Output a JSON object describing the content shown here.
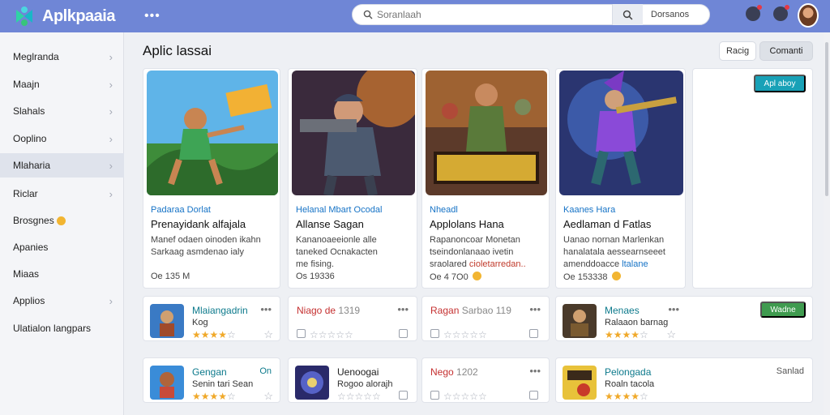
{
  "app": {
    "name": "Aplkpaaia",
    "menu_icon": "more-dots-icon"
  },
  "search": {
    "placeholder": "Soranlaah",
    "scope": "Dorsanos"
  },
  "header_icons": [
    "notification-icon",
    "settings-icon"
  ],
  "sidebar": {
    "items": [
      {
        "label": "Meglranda"
      },
      {
        "label": "Maajn"
      },
      {
        "label": "Slahals"
      },
      {
        "label": "Ooplino"
      },
      {
        "label": "Mlaharia"
      },
      {
        "label": "Riclar"
      },
      {
        "label": "Brosgnes"
      },
      {
        "label": "Apanies"
      },
      {
        "label": "Miaas"
      },
      {
        "label": "Applios"
      },
      {
        "label": "Ulatialon langpars"
      }
    ]
  },
  "main": {
    "title": "Aplic lassai",
    "btn_a": "Racig",
    "btn_b": "Comanti",
    "blank_button": "Apl aboy"
  },
  "featured": [
    {
      "category": "Padaraa Dorlat",
      "title": "Prenayidank alfajala",
      "desc1": "Manef odaen oinoden ikahn",
      "desc2": "Sarkaag asmdenao ialy",
      "desc3": "",
      "meta": "Oe 135 M"
    },
    {
      "category": "Helanal Mbart Ocodal",
      "title": "Allanse Sagan",
      "desc1": "Kananoaeeionle alle",
      "desc2": "taneked Ocnakacten",
      "desc3": "me fising.",
      "meta": "Os 19336"
    },
    {
      "category": "Nheadl",
      "title": "Applolans Hana",
      "desc1": "Rapanoncoar Monetan",
      "desc2": "tseindonlanaao ivetin",
      "desc3_a": "sraolared",
      "desc3_b": "cioletarredan..",
      "meta": "Oe 4 7O0"
    },
    {
      "category": "Kaanes Hara",
      "title": "Aedlaman d Fatlas",
      "desc1": "Uanao nornan Marlenkan",
      "desc2": "hanalatala aessearnseeet",
      "desc3_a": "amenddoacce",
      "desc3_b": "ltalane",
      "meta": "Oe 153338"
    }
  ],
  "row1": [
    {
      "name": "Mlaiangadrin",
      "sub": "Kog",
      "stars": "★★★★",
      "off": "☆",
      "more": "•••"
    },
    {
      "name": "Niago de",
      "extra_num": "1319",
      "more": "•••",
      "stars_off": "☆☆☆☆☆"
    },
    {
      "name": "Ragan",
      "name2": "Sarbao 119",
      "more": "•••",
      "stars_off": "☆☆☆☆☆"
    },
    {
      "name": "Menaes",
      "sub": "Ralaaon barnag",
      "stars": "★★★★",
      "off": "☆",
      "more": "•••",
      "button": "Wadne"
    }
  ],
  "row2": [
    {
      "name": "Gengan",
      "extra": "On",
      "sub": "Senin tari Sean",
      "stars": "★★★★",
      "off": "☆"
    },
    {
      "name": "Uenoogai",
      "sub": "Rogoo alorajh",
      "stars_off": "☆☆☆☆☆"
    },
    {
      "name": "Nego",
      "extra_num": "1202",
      "more": "•••",
      "stars_off": "☆☆☆☆☆"
    },
    {
      "name": "Pelongada",
      "extra": "Sanlad",
      "sub": "Roaln tacola",
      "stars": "★★★★",
      "off": "☆"
    }
  ],
  "colors": {
    "header": "#6f86d6",
    "accent_teal": "#18a1b7",
    "accent_green": "#3f9b4f",
    "star": "#f0a92a"
  }
}
